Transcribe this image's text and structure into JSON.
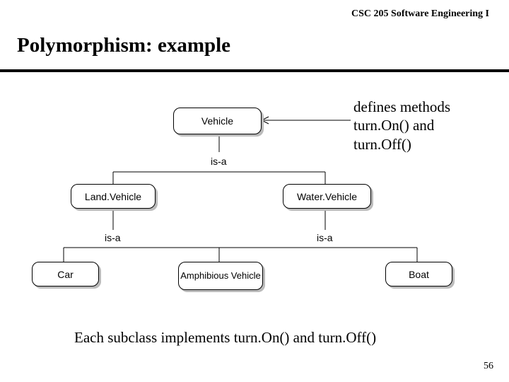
{
  "course_header": "CSC 205 Software Engineering I",
  "slide_title": "Polymorphism: example",
  "diagram": {
    "root_box": "Vehicle",
    "annotation": "defines methods turn.On() and turn.Off()",
    "isa_top": "is-a",
    "mid_left_box": "Land.Vehicle",
    "mid_right_box": "Water.Vehicle",
    "isa_left": "is-a",
    "isa_right": "is-a",
    "leaf_car": "Car",
    "leaf_amphibious": "Amphibious Vehicle",
    "leaf_boat": "Boat"
  },
  "footer_text": "Each subclass implements turn.On() and turn.Off()",
  "page_number": "56"
}
